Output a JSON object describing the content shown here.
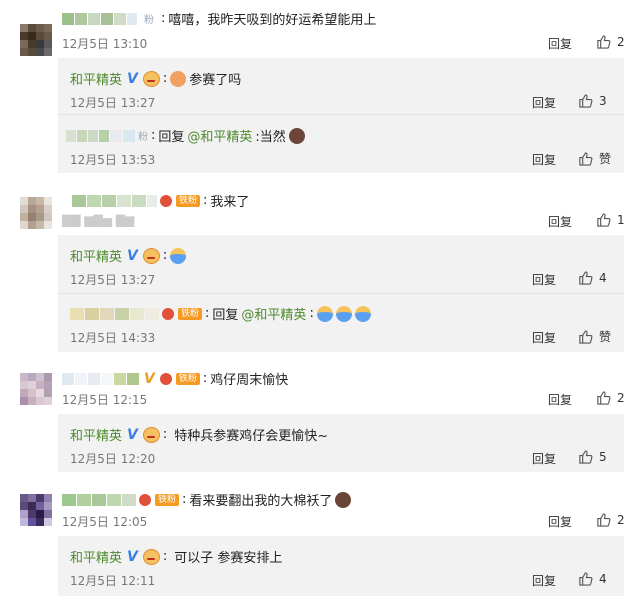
{
  "colors": {
    "official_name": "#4c8a2c",
    "mention": "#4c8a2c",
    "verified": "#3b7de6",
    "sub_bg": "#f2f2f2"
  },
  "labels": {
    "reply": "回复",
    "reply_prefix": "回复",
    "official_name": "和平精英",
    "fan_badge": "铁粉",
    "pink_badge": "粉",
    "like_text": "赞"
  },
  "comments": [
    {
      "text": "嘻嘻，我昨天吸到的好运希望能用上",
      "time": "12月5日 13:10",
      "likes": "2",
      "replies": [
        {
          "text": "参赛了吗",
          "time": "12月5日 13:27",
          "likes": "3"
        },
        {
          "mention": "@和平精英",
          "text": ":当然",
          "time": "12月5日 13:53",
          "likes": "赞"
        }
      ]
    },
    {
      "text": "我来了",
      "time": "12月5日 13:20",
      "likes": "1",
      "replies": [
        {
          "text": "",
          "time": "12月5日 13:27",
          "likes": "4"
        },
        {
          "mention": "@和平精英",
          "text": ":",
          "time": "12月5日 14:33",
          "likes": "赞"
        }
      ]
    },
    {
      "text": "鸡仔周末愉快",
      "time": "12月5日 12:15",
      "likes": "2",
      "replies": [
        {
          "text": "特种兵参赛鸡仔会更愉快~",
          "time": "12月5日 12:20",
          "likes": "5"
        }
      ]
    },
    {
      "text": "看来要翻出我的大棉袄了",
      "time": "12月5日 12:05",
      "likes": "2",
      "replies": [
        {
          "text": "可以子 参赛安排上",
          "time": "12月5日 12:11",
          "likes": "4"
        }
      ]
    }
  ]
}
